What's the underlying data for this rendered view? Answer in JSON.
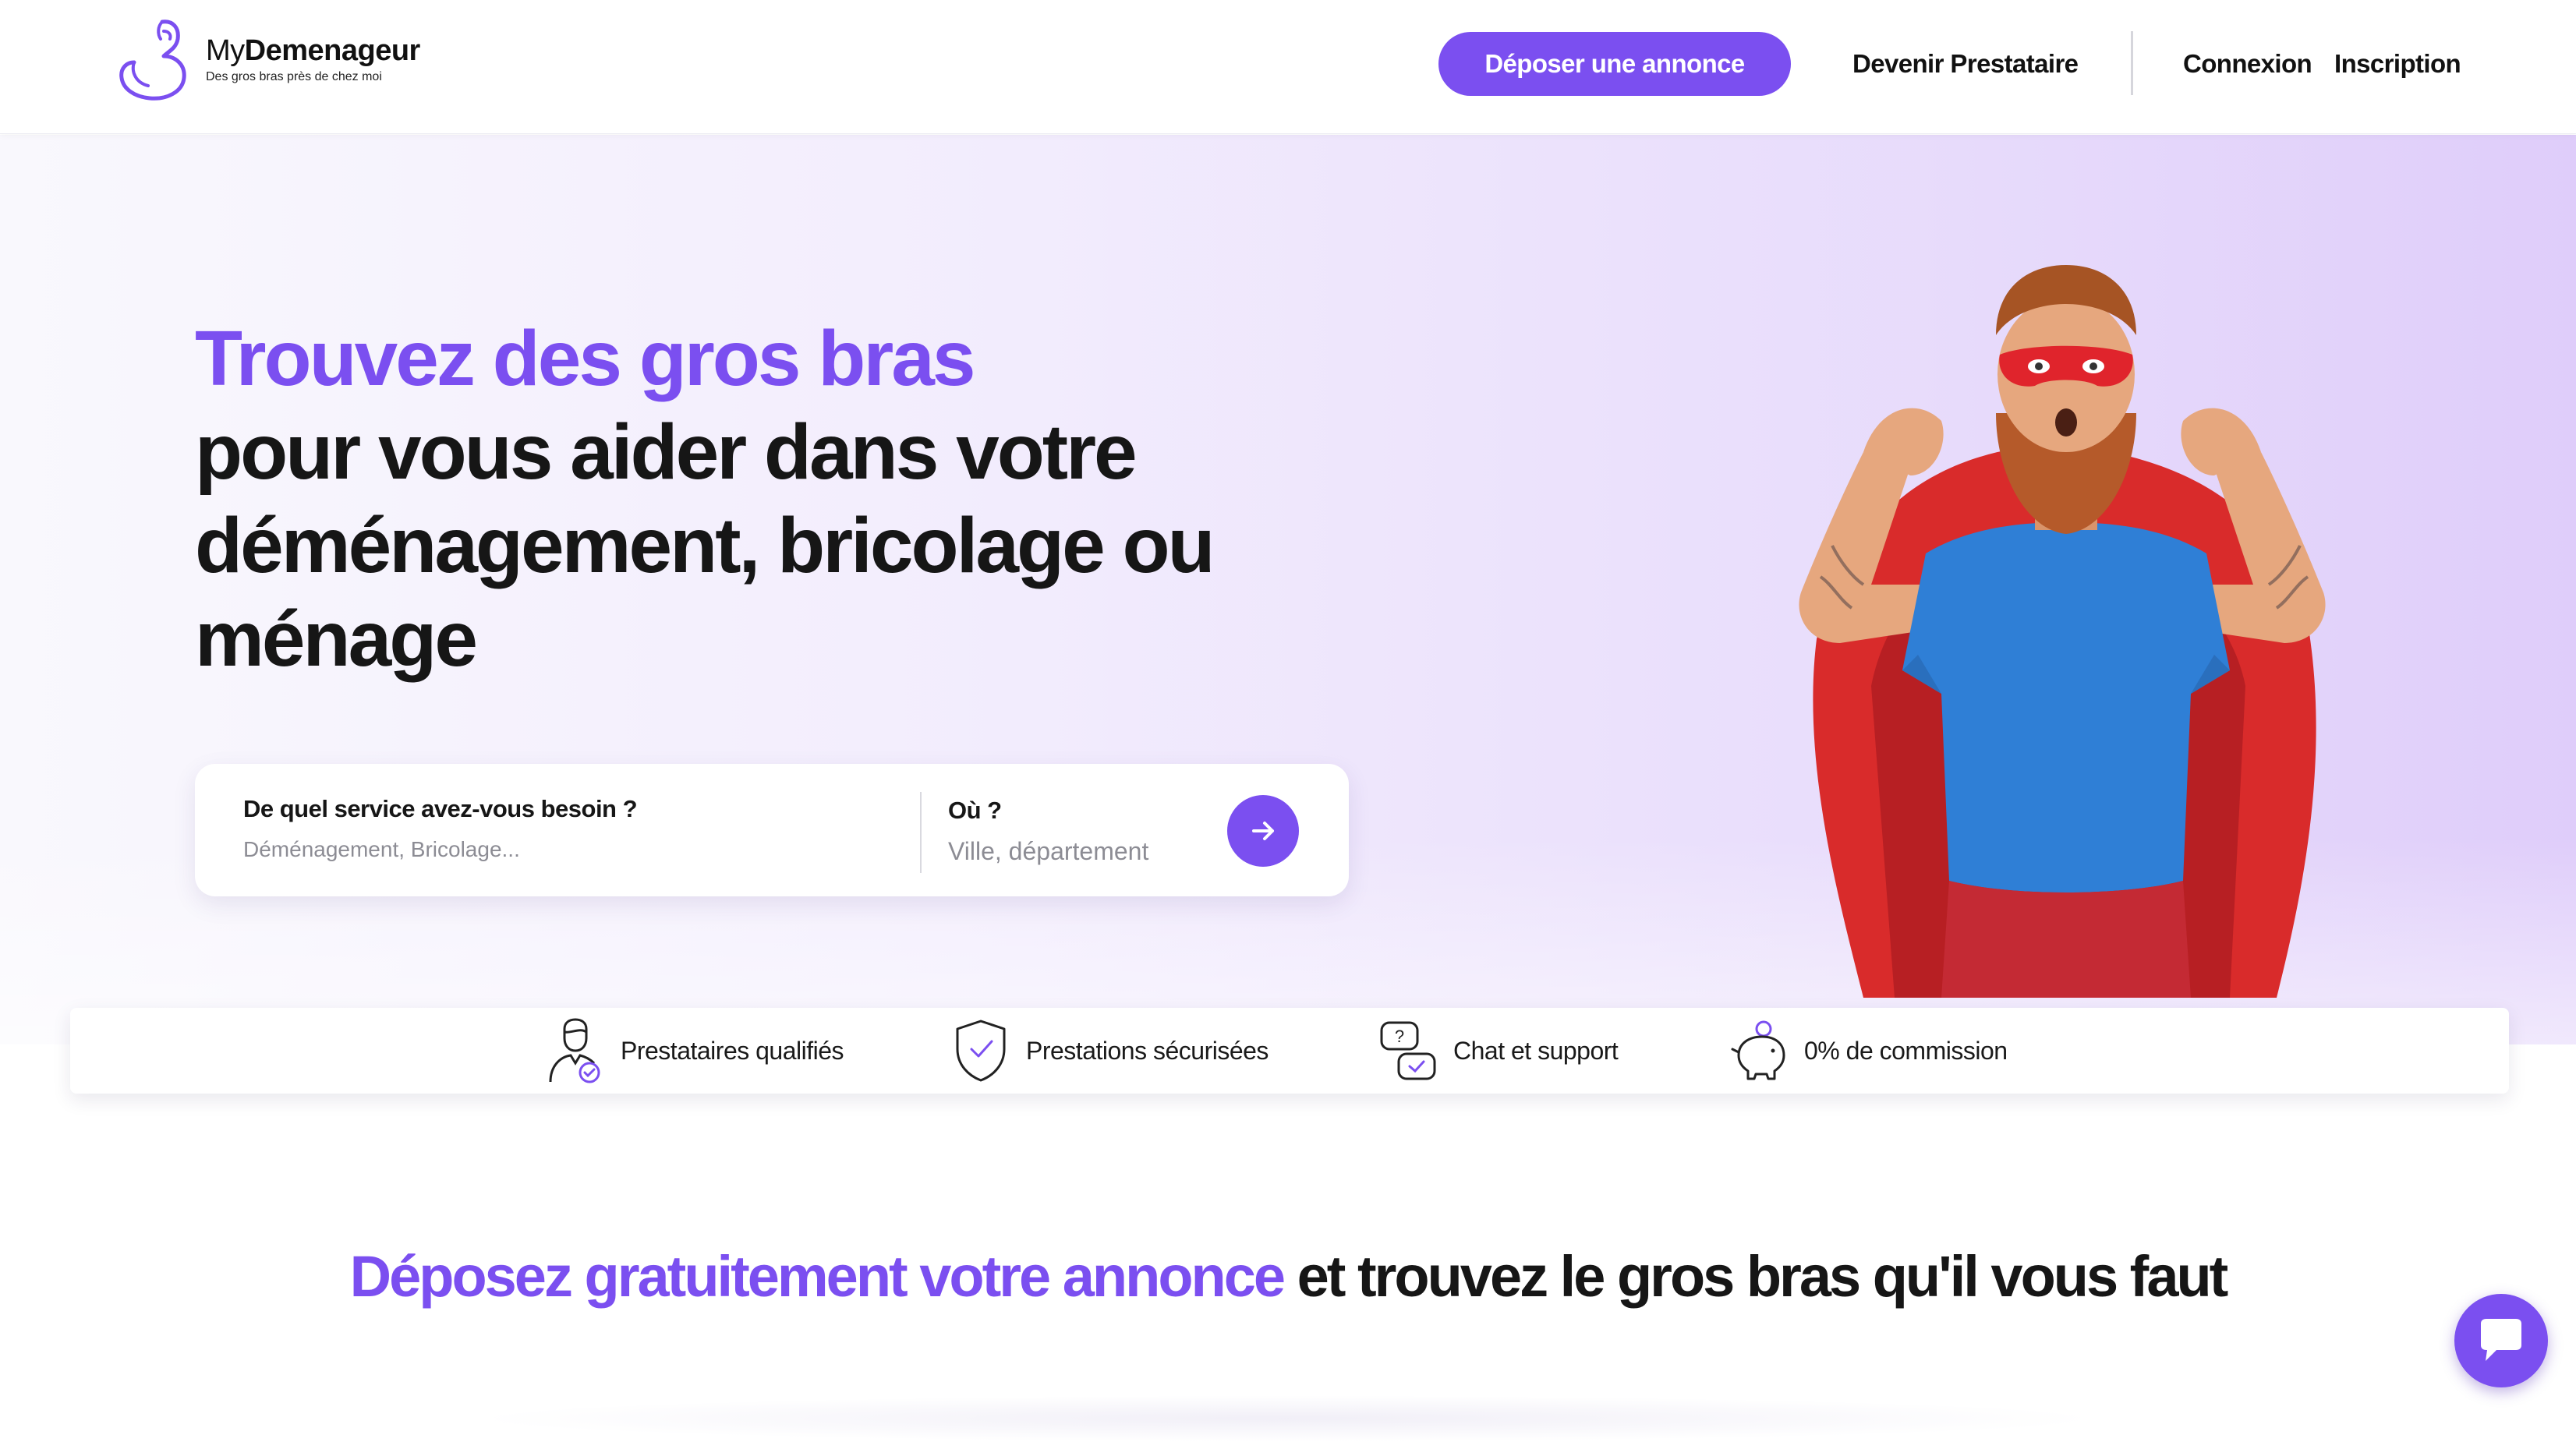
{
  "brand": {
    "name_prefix": "My",
    "name_bold": "Demenageur",
    "tagline": "Des gros bras près de chez moi",
    "accent_color": "#7b4ff0"
  },
  "nav": {
    "cta_label": "Déposer une annonce",
    "become_provider": "Devenir Prestataire",
    "login": "Connexion",
    "signup": "Inscription"
  },
  "hero": {
    "title_accent": "Trouvez des gros bras",
    "title_rest": "pour vous aider dans votre déménagement, bricolage ou ménage"
  },
  "search": {
    "service_label": "De quel service avez-vous besoin ?",
    "service_placeholder": "Déménagement, Bricolage...",
    "location_label": "Où ?",
    "location_placeholder": "Ville, département",
    "submit_icon": "arrow-right-icon"
  },
  "features": [
    {
      "icon": "qualified-provider-icon",
      "label": "Prestataires qualifiés"
    },
    {
      "icon": "shield-check-icon",
      "label": "Prestations sécurisées"
    },
    {
      "icon": "chat-support-icon",
      "label": "Chat et support"
    },
    {
      "icon": "piggy-bank-icon",
      "label": "0% de commission"
    }
  ],
  "section": {
    "heading_accent": "Déposez gratuitement votre annonce",
    "heading_rest": "et trouvez le gros bras qu'il vous faut"
  },
  "chat": {
    "icon": "chat-bubble-icon"
  }
}
